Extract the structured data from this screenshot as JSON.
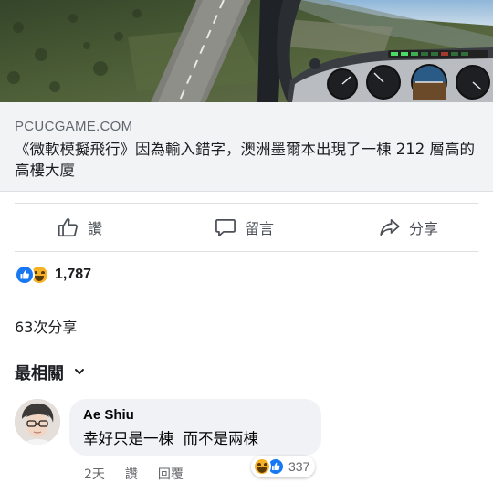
{
  "link_preview": {
    "domain": "PCUCGAME.COM",
    "title": "《微軟模擬飛行》因為輸入錯字，澳洲墨爾本出現了一棟 212 層高的高樓大廈"
  },
  "actions": {
    "like_label": "讚",
    "comment_label": "留言",
    "share_label": "分享"
  },
  "reactions": {
    "icons": [
      "like-icon",
      "haha-icon"
    ],
    "count": "1,787"
  },
  "shares_text": "63次分享",
  "comments_filter": {
    "label": "最相關",
    "icon": "chevron-down-icon"
  },
  "comment": {
    "author": "Ae Shiu",
    "text": "幸好只是一棟  而不是兩棟",
    "time": "2天",
    "like_label": "讚",
    "reply_label": "回覆",
    "reaction_icons": [
      "haha-icon",
      "like-icon"
    ],
    "reaction_count": "337"
  },
  "colors": {
    "accent": "#1877f2",
    "haha": "#f7b125",
    "caption_bg": "#f2f3f5",
    "bubble_bg": "#f0f2f5",
    "text_secondary": "#65676b"
  }
}
